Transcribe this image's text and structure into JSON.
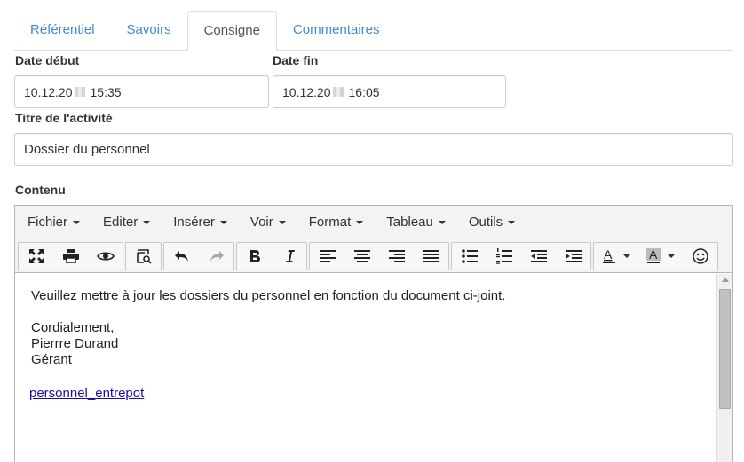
{
  "tabs": [
    {
      "label": "Référentiel",
      "active": false
    },
    {
      "label": "Savoirs",
      "active": false
    },
    {
      "label": "Consigne",
      "active": true
    },
    {
      "label": "Commentaires",
      "active": false
    }
  ],
  "form": {
    "start_label": "Date début",
    "start_prefix": "10.12.20",
    "start_time": "15:35",
    "end_label": "Date fin",
    "end_prefix": "10.12.20",
    "end_time": "16:05",
    "title_label": "Titre de l'activité",
    "title_value": "Dossier du personnel",
    "content_label": "Contenu"
  },
  "editor": {
    "menus": [
      "Fichier",
      "Editer",
      "Insérer",
      "Voir",
      "Format",
      "Tableau",
      "Outils"
    ],
    "toolbar_icons": [
      "fullscreen-icon",
      "print-icon",
      "preview-icon",
      "find-replace-icon",
      "undo-icon",
      "redo-icon",
      "bold-icon",
      "italic-icon",
      "align-left-icon",
      "align-center-icon",
      "align-right-icon",
      "align-justify-icon",
      "bullet-list-icon",
      "numbered-list-icon",
      "outdent-icon",
      "indent-icon",
      "text-color-icon",
      "background-color-icon",
      "emoticon-icon"
    ],
    "body": {
      "line1": "Veuillez mettre à jour les dossiers du personnel en fonction du document ci-joint.",
      "line2": "Cordialement,",
      "line3": "Pierrre Durand",
      "line4": "Gérant",
      "link": "personnel_entrepot"
    }
  }
}
